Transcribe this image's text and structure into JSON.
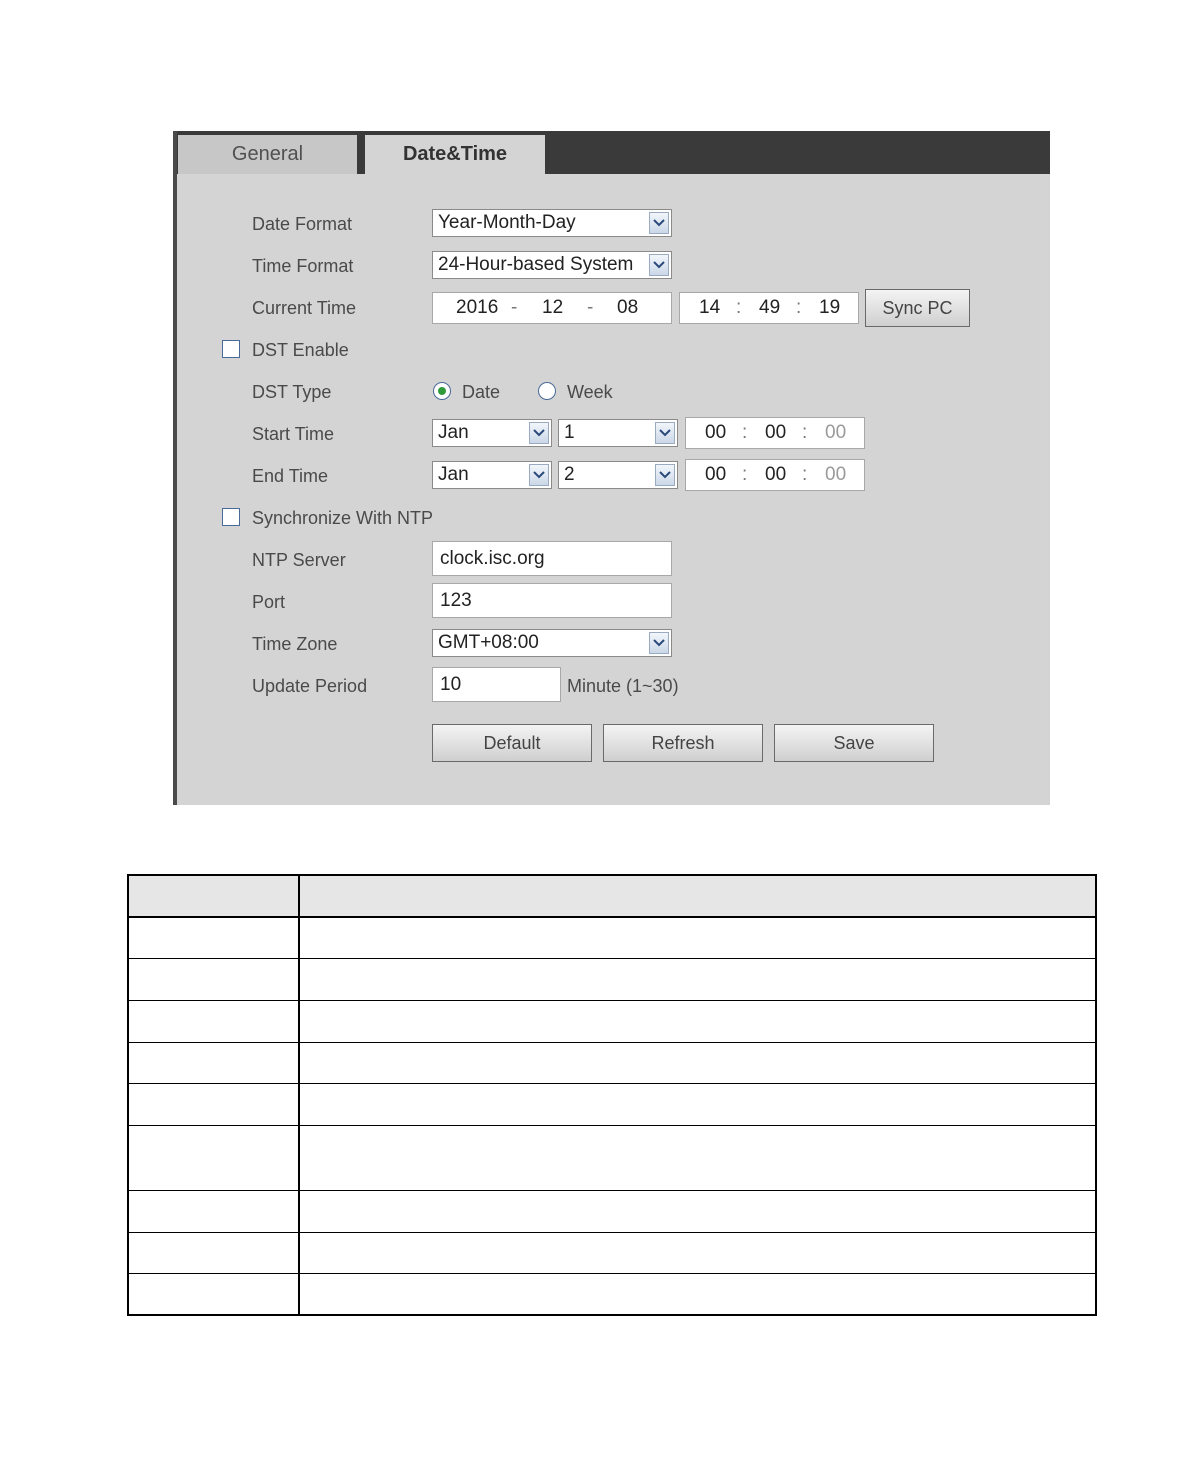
{
  "tabs": {
    "general": "General",
    "date_time": "Date&Time"
  },
  "form": {
    "date_format": {
      "label": "Date Format",
      "value": "Year-Month-Day"
    },
    "time_format": {
      "label": "Time Format",
      "value": "24-Hour-based System"
    },
    "current_time": {
      "label": "Current Time",
      "year": "2016",
      "month": "12",
      "day": "08",
      "hour": "14",
      "minute": "49",
      "second": "19",
      "date_sep": "-",
      "time_sep": ":",
      "sync_button": "Sync PC"
    },
    "dst_enable": {
      "label": "DST Enable",
      "checked": false
    },
    "dst_type": {
      "label": "DST Type",
      "option_date": "Date",
      "option_week": "Week",
      "selected": "Date"
    },
    "start_time": {
      "label": "Start Time",
      "month": "Jan",
      "day": "1",
      "hour": "00",
      "minute": "00",
      "second": "00"
    },
    "end_time": {
      "label": "End Time",
      "month": "Jan",
      "day": "2",
      "hour": "00",
      "minute": "00",
      "second": "00"
    },
    "ntp_sync": {
      "label": "Synchronize With NTP",
      "checked": false
    },
    "ntp_server": {
      "label": "NTP Server",
      "value": "clock.isc.org"
    },
    "port": {
      "label": "Port",
      "value": "123"
    },
    "time_zone": {
      "label": "Time Zone",
      "value": "GMT+08:00"
    },
    "update_period": {
      "label": "Update Period",
      "value": "10",
      "unit": "Minute (1~30)"
    }
  },
  "buttons": {
    "default": "Default",
    "refresh": "Refresh",
    "save": "Save"
  },
  "icons": {
    "dropdown": "chevron-down-icon",
    "checkbox": "checkbox-icon",
    "radio": "radio-icon"
  },
  "colors": {
    "tab_bar": "#3a3a3a",
    "panel_bg": "#d4d4d4",
    "radio_selected": "#2f9a3a"
  }
}
